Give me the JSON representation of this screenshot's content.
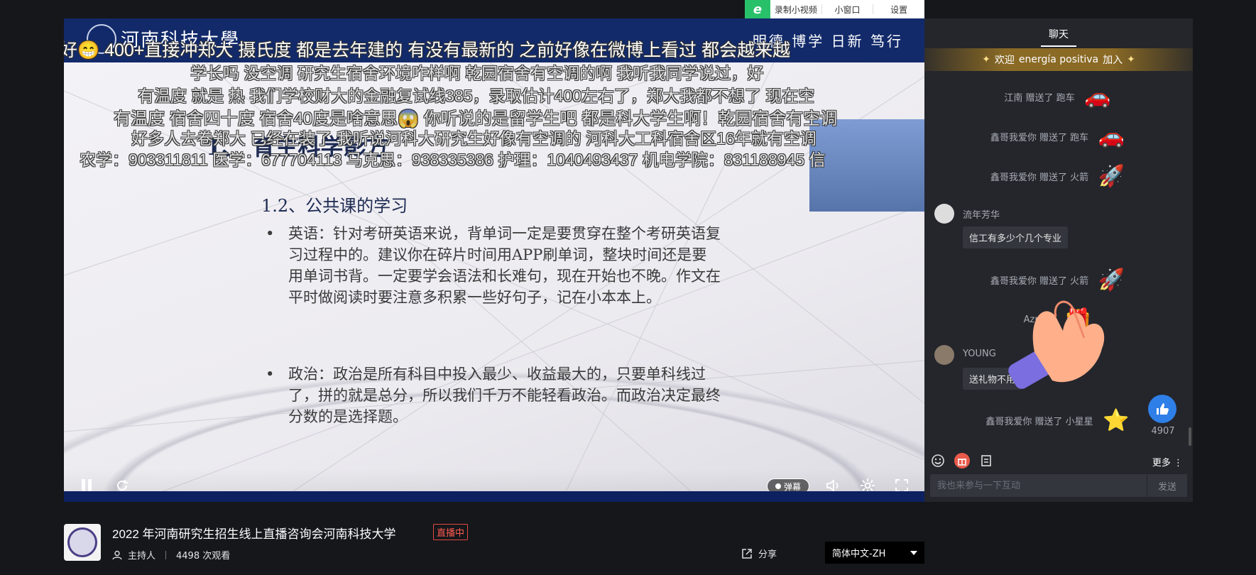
{
  "topbar": {
    "record_label": "录制小视频",
    "mini_window_label": "小窗口",
    "settings_label": "设置"
  },
  "slide": {
    "university_name": "河南科技大學",
    "motto": "明德 博学 日新 笃行",
    "title": "1、 育主科学影方",
    "subtitle": "1.2、公共课的学习",
    "bullet1": "英语：针对考研英语来说，背单词一定是要贯穿在整个考研英语复习过程中的。建议你在碎片时间用APP刷单词，整块时间还是要用单词书背。一定要学会语法和长难句，现在开始也不晚。作文在平时做阅读时要注意多积累一些好句子，记在小本本上。",
    "bullet2": "政治：政治是所有科目中投入最少、收益最大的，只要单科线过了，拼的就是总分，所以我们千万不能轻看政治。而政治决定最终分数的是选择题。"
  },
  "danmaku": [
    "好😁  400+直接冲郑大  摄氏度    都是去年建的  有没有最新的       之前好像在微博上看过    都会越来越",
    "学长吗  没空调       研究生宿舍环境咋样啊       乾园宿舍有空调的啊   我听我同学说过，好",
    "有温度 就是 热   我们学校财大的金融复试线385，录取估计400左右了，郑大我都不想了   现在空",
    "有温度 宿舍四十度   宿舍40度是啥意思😱       你听说的是留学生吧   都是科大学生啊！乾园宿舍有空调",
    "好多人去卷郑大     已经在装了 我听说河科大研究生好像有空调的  河科大工科宿舍区16年就有空调",
    "农学：903311811 医学：677704113 马克思：938335386 护理：1040493437 机电学院：831188945 信"
  ],
  "controls": {
    "danmu_label": "弹幕"
  },
  "chat": {
    "tab_label": "聊天",
    "welcome_prefix": "欢迎",
    "welcome_user": "energía positiva",
    "welcome_suffix": "加入",
    "gifts": [
      {
        "text": "江南 赠送了 跑车",
        "icon": "sports-car-icon"
      },
      {
        "text": "鑫哥我爱你 赠送了 跑车",
        "icon": "sports-car-icon"
      },
      {
        "text": "鑫哥我爱你 赠送了 火箭",
        "icon": "rocket-icon"
      },
      {
        "text": "鑫哥我爱你 赠送了 火箭",
        "icon": "rocket-icon"
      },
      {
        "text": "Azrael.",
        "icon": "gift-icon"
      },
      {
        "text": "鑫哥我爱你 赠送了 小星星",
        "icon": "star-icon"
      }
    ],
    "messages": [
      {
        "user": "流年芳华",
        "text": "信工有多少个几个专业"
      },
      {
        "user": "YOUNG",
        "text": "送礼物不用"
      }
    ],
    "like_count": "4907",
    "more_label": "更多",
    "input_placeholder": "我也来参与一下互动",
    "send_label": "发送"
  },
  "info": {
    "title": "2022 年河南研究生招生线上直播咨询会河南科技大学",
    "live_badge": "直播中",
    "host_label": "主持人",
    "views": "4498 次观看",
    "share_label": "分享",
    "language": "简体中文-ZH"
  }
}
